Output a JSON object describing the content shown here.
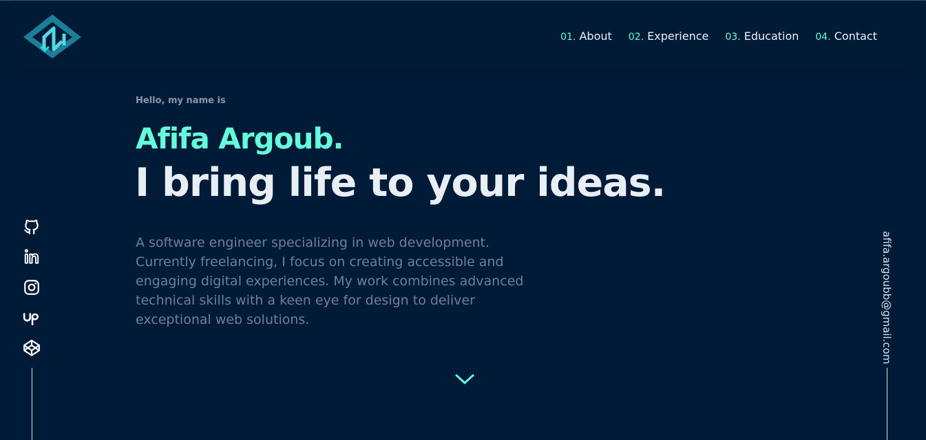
{
  "header": {
    "logo_icon": "diamond-monogram-logo",
    "nav": [
      {
        "number": "01.",
        "label": "About"
      },
      {
        "number": "02.",
        "label": "Experience"
      },
      {
        "number": "03.",
        "label": "Education"
      },
      {
        "number": "04.",
        "label": "Contact"
      }
    ]
  },
  "hero": {
    "greeting": "Hello, my name is",
    "name": "Afifa Argoub.",
    "tagline": "I bring life to your ideas.",
    "description": "A software engineer specializing in web development. Currently freelancing, I focus on creating accessible and engaging digital experiences. My work combines advanced technical skills with a keen eye for design to deliver exceptional web solutions.",
    "scroll_icon": "chevron-down-icon"
  },
  "socials": [
    {
      "name": "github-icon"
    },
    {
      "name": "linkedin-icon"
    },
    {
      "name": "instagram-icon"
    },
    {
      "name": "upwork-icon"
    },
    {
      "name": "codepen-icon"
    }
  ],
  "email": "afifa.argoubb@gmail.com",
  "colors": {
    "background": "#001b38",
    "accent": "#64ffda",
    "text": "#e6ecf3",
    "muted": "#6f7f95"
  }
}
